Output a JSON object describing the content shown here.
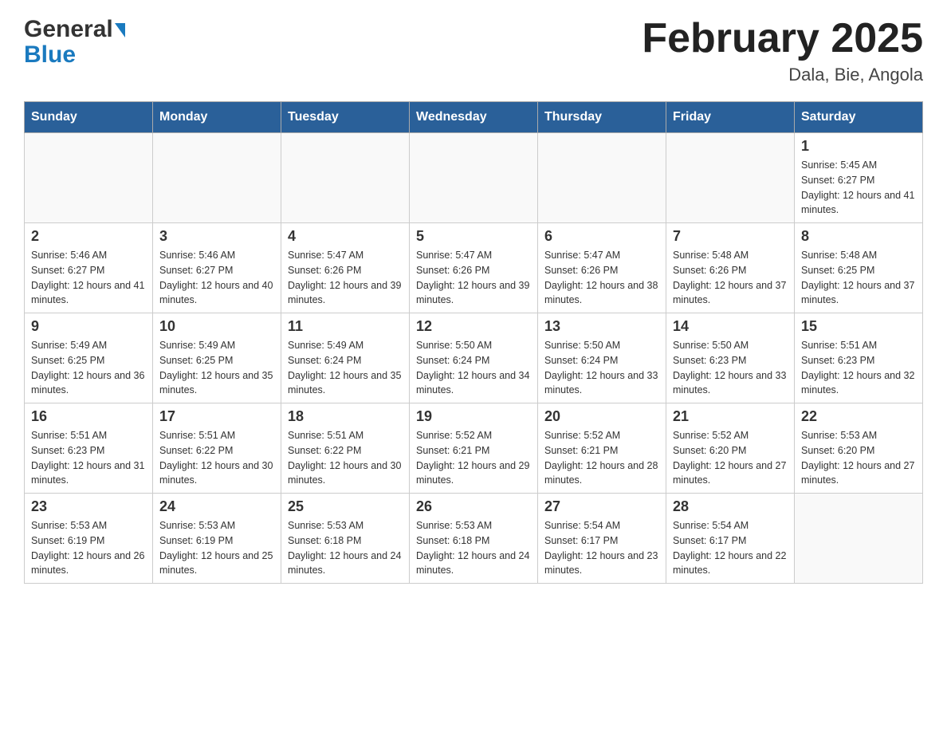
{
  "header": {
    "logo_general": "General",
    "logo_blue": "Blue",
    "title": "February 2025",
    "subtitle": "Dala, Bie, Angola"
  },
  "calendar": {
    "days_of_week": [
      "Sunday",
      "Monday",
      "Tuesday",
      "Wednesday",
      "Thursday",
      "Friday",
      "Saturday"
    ],
    "weeks": [
      [
        {
          "day": "",
          "info": ""
        },
        {
          "day": "",
          "info": ""
        },
        {
          "day": "",
          "info": ""
        },
        {
          "day": "",
          "info": ""
        },
        {
          "day": "",
          "info": ""
        },
        {
          "day": "",
          "info": ""
        },
        {
          "day": "1",
          "info": "Sunrise: 5:45 AM\nSunset: 6:27 PM\nDaylight: 12 hours and 41 minutes."
        }
      ],
      [
        {
          "day": "2",
          "info": "Sunrise: 5:46 AM\nSunset: 6:27 PM\nDaylight: 12 hours and 41 minutes."
        },
        {
          "day": "3",
          "info": "Sunrise: 5:46 AM\nSunset: 6:27 PM\nDaylight: 12 hours and 40 minutes."
        },
        {
          "day": "4",
          "info": "Sunrise: 5:47 AM\nSunset: 6:26 PM\nDaylight: 12 hours and 39 minutes."
        },
        {
          "day": "5",
          "info": "Sunrise: 5:47 AM\nSunset: 6:26 PM\nDaylight: 12 hours and 39 minutes."
        },
        {
          "day": "6",
          "info": "Sunrise: 5:47 AM\nSunset: 6:26 PM\nDaylight: 12 hours and 38 minutes."
        },
        {
          "day": "7",
          "info": "Sunrise: 5:48 AM\nSunset: 6:26 PM\nDaylight: 12 hours and 37 minutes."
        },
        {
          "day": "8",
          "info": "Sunrise: 5:48 AM\nSunset: 6:25 PM\nDaylight: 12 hours and 37 minutes."
        }
      ],
      [
        {
          "day": "9",
          "info": "Sunrise: 5:49 AM\nSunset: 6:25 PM\nDaylight: 12 hours and 36 minutes."
        },
        {
          "day": "10",
          "info": "Sunrise: 5:49 AM\nSunset: 6:25 PM\nDaylight: 12 hours and 35 minutes."
        },
        {
          "day": "11",
          "info": "Sunrise: 5:49 AM\nSunset: 6:24 PM\nDaylight: 12 hours and 35 minutes."
        },
        {
          "day": "12",
          "info": "Sunrise: 5:50 AM\nSunset: 6:24 PM\nDaylight: 12 hours and 34 minutes."
        },
        {
          "day": "13",
          "info": "Sunrise: 5:50 AM\nSunset: 6:24 PM\nDaylight: 12 hours and 33 minutes."
        },
        {
          "day": "14",
          "info": "Sunrise: 5:50 AM\nSunset: 6:23 PM\nDaylight: 12 hours and 33 minutes."
        },
        {
          "day": "15",
          "info": "Sunrise: 5:51 AM\nSunset: 6:23 PM\nDaylight: 12 hours and 32 minutes."
        }
      ],
      [
        {
          "day": "16",
          "info": "Sunrise: 5:51 AM\nSunset: 6:23 PM\nDaylight: 12 hours and 31 minutes."
        },
        {
          "day": "17",
          "info": "Sunrise: 5:51 AM\nSunset: 6:22 PM\nDaylight: 12 hours and 30 minutes."
        },
        {
          "day": "18",
          "info": "Sunrise: 5:51 AM\nSunset: 6:22 PM\nDaylight: 12 hours and 30 minutes."
        },
        {
          "day": "19",
          "info": "Sunrise: 5:52 AM\nSunset: 6:21 PM\nDaylight: 12 hours and 29 minutes."
        },
        {
          "day": "20",
          "info": "Sunrise: 5:52 AM\nSunset: 6:21 PM\nDaylight: 12 hours and 28 minutes."
        },
        {
          "day": "21",
          "info": "Sunrise: 5:52 AM\nSunset: 6:20 PM\nDaylight: 12 hours and 27 minutes."
        },
        {
          "day": "22",
          "info": "Sunrise: 5:53 AM\nSunset: 6:20 PM\nDaylight: 12 hours and 27 minutes."
        }
      ],
      [
        {
          "day": "23",
          "info": "Sunrise: 5:53 AM\nSunset: 6:19 PM\nDaylight: 12 hours and 26 minutes."
        },
        {
          "day": "24",
          "info": "Sunrise: 5:53 AM\nSunset: 6:19 PM\nDaylight: 12 hours and 25 minutes."
        },
        {
          "day": "25",
          "info": "Sunrise: 5:53 AM\nSunset: 6:18 PM\nDaylight: 12 hours and 24 minutes."
        },
        {
          "day": "26",
          "info": "Sunrise: 5:53 AM\nSunset: 6:18 PM\nDaylight: 12 hours and 24 minutes."
        },
        {
          "day": "27",
          "info": "Sunrise: 5:54 AM\nSunset: 6:17 PM\nDaylight: 12 hours and 23 minutes."
        },
        {
          "day": "28",
          "info": "Sunrise: 5:54 AM\nSunset: 6:17 PM\nDaylight: 12 hours and 22 minutes."
        },
        {
          "day": "",
          "info": ""
        }
      ]
    ]
  }
}
